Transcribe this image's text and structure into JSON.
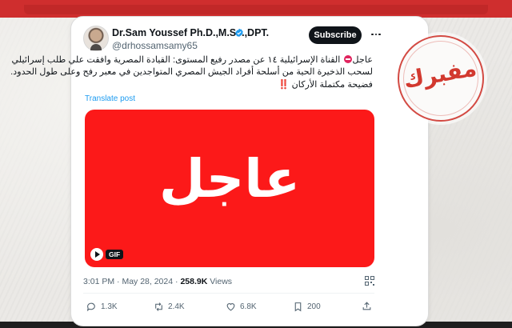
{
  "tweet": {
    "author_name": "Dr.Sam Youssef Ph.D.,M.Sc.,DPT.",
    "handle": "@drhossamsamy65",
    "subscribe_label": "Subscribe",
    "text_line1_a": "عاجل",
    "text_line1_b": "القناة الإسرائيلية ١٤ عن مصدر رفيع المستوى: القيادة المصرية وافقت علي طلب إسرائيلي",
    "text_line2": "لسحب الذخيرة الحية من أسلحة أفراد الجيش المصري المتواجدين في معبر رفح وعلى طول الحدود.",
    "text_line3_a": "فضيحة مكتملة الأركان",
    "text_line3_b": "‼️",
    "translate_label": "Translate post",
    "media_text": "عاجل",
    "gif_label": "GIF",
    "time": "3:01 PM",
    "date": "May 28, 2024",
    "views_count": "258.9K",
    "views_label": "Views",
    "replies": "1.3K",
    "reposts": "2.4K",
    "likes": "6.8K",
    "bookmarks": "200"
  },
  "stamp": {
    "label": "مفبرك",
    "color": "#d2392f"
  },
  "colors": {
    "top_bar": "#cf2e2e",
    "media_bg": "#fc1919",
    "link": "#1d9bf0",
    "verified": "#1d9bf0"
  },
  "icons": [
    "verified-badge-icon",
    "more-icon",
    "no-entry-icon",
    "play-icon",
    "qr-code-icon",
    "reply-icon",
    "repost-icon",
    "like-icon",
    "bookmark-icon",
    "share-icon"
  ]
}
